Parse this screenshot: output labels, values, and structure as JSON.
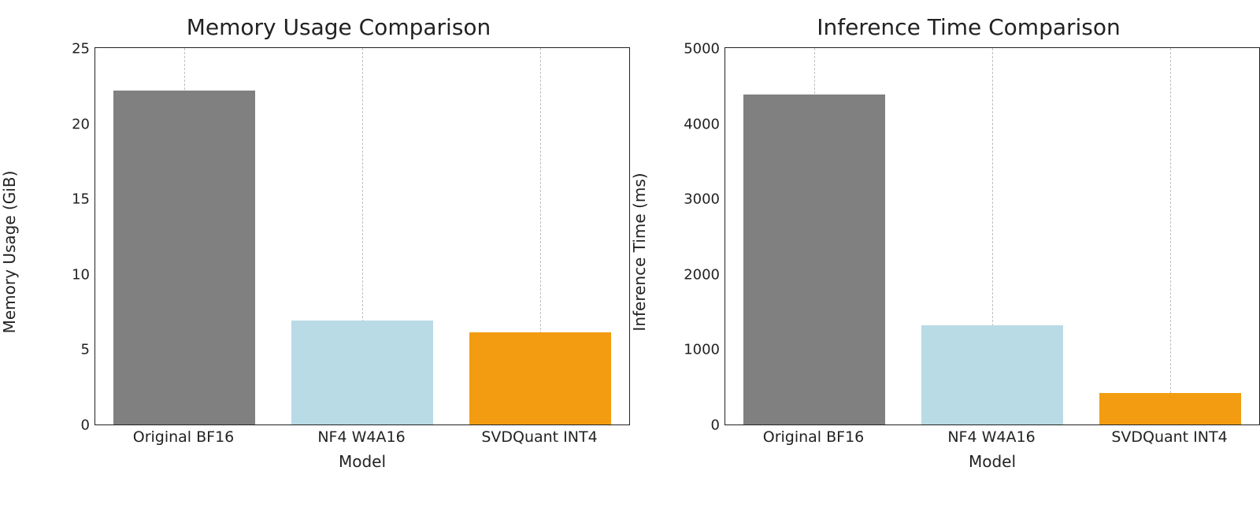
{
  "chart_data": [
    {
      "type": "bar",
      "title": "Memory Usage Comparison",
      "xlabel": "Model",
      "ylabel": "Memory Usage (GiB)",
      "ylim": [
        0,
        25
      ],
      "yticks": [
        0,
        5,
        10,
        15,
        20,
        25
      ],
      "categories": [
        "Original BF16",
        "NF4 W4A16",
        "SVDQuant INT4"
      ],
      "values": [
        22.2,
        6.9,
        6.1
      ],
      "colors": [
        "#808080",
        "#b9dbe6",
        "#f39c12"
      ]
    },
    {
      "type": "bar",
      "title": "Inference Time Comparison",
      "xlabel": "Model",
      "ylabel": "Inference Time (ms)",
      "ylim": [
        0,
        5000
      ],
      "yticks": [
        0,
        1000,
        2000,
        3000,
        4000,
        5000
      ],
      "categories": [
        "Original BF16",
        "NF4 W4A16",
        "SVDQuant INT4"
      ],
      "values": [
        4380,
        1320,
        420
      ],
      "colors": [
        "#808080",
        "#b9dbe6",
        "#f39c12"
      ]
    }
  ]
}
